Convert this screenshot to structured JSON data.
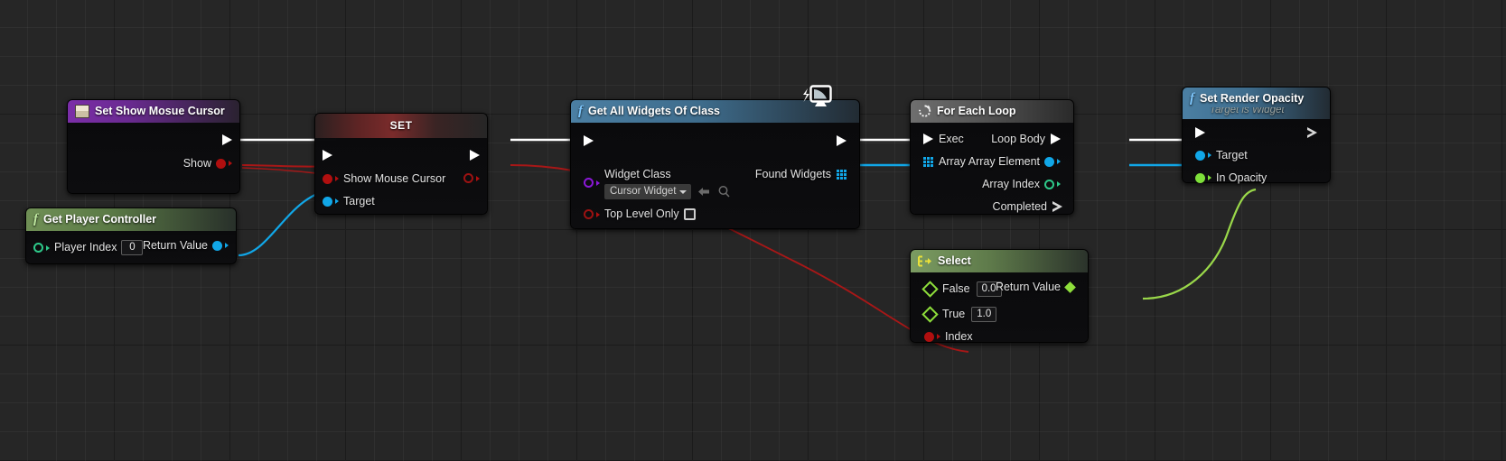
{
  "app": {
    "name": "Unreal Engine Blueprint Graph",
    "canvas_bg": "#262626",
    "grid_minor": "#2e2e2e",
    "grid_major": "#161616"
  },
  "nodes": [
    {
      "id": "set-show-mouse-cursor",
      "title": "Set Show Mosue Cursor",
      "subtitle": "",
      "header_color": "#7b2ea8",
      "icon": "variable-icon",
      "inputs": [],
      "outputs": [
        {
          "label": "",
          "pin": "exec-out-pin"
        },
        {
          "label": "Show",
          "pin": "bool-out-pin",
          "color": "#b00f0f"
        }
      ]
    },
    {
      "id": "set",
      "title": "SET",
      "subtitle": "",
      "header_color": "#7a2b2b",
      "icon": "",
      "inputs": [
        {
          "label": "",
          "pin": "exec-in-pin"
        },
        {
          "label": "Show Mouse Cursor",
          "pin": "bool-in-pin",
          "color": "#b00f0f"
        },
        {
          "label": "Target",
          "pin": "object-in-pin",
          "color": "#11a7e8"
        }
      ],
      "outputs": [
        {
          "label": "",
          "pin": "exec-out-pin"
        },
        {
          "label": "",
          "pin": "bool-out-pin",
          "color": "#b00f0f"
        }
      ]
    },
    {
      "id": "get-player-controller",
      "title": "Get Player Controller",
      "subtitle": "",
      "header_color": "#6f8f55",
      "icon": "function-icon",
      "inputs": [
        {
          "label": "Player Index",
          "pin": "int-in-pin",
          "value": "0",
          "color": "#2ec98a"
        }
      ],
      "outputs": [
        {
          "label": "Return Value",
          "pin": "object-out-pin",
          "color": "#11a7e8"
        }
      ]
    },
    {
      "id": "get-all-widgets-of-class",
      "title": "Get All Widgets Of Class",
      "subtitle": "",
      "header_color": "#4b7fa3",
      "icon": "function-icon",
      "badge": "monitor-icon",
      "inputs": [
        {
          "label": "",
          "pin": "exec-in-pin"
        },
        {
          "label": "Widget Class",
          "pin": "class-in-pin",
          "value": "Cursor Widget",
          "color": "#8b18d8"
        },
        {
          "label": "Top Level Only",
          "pin": "bool-in-pin",
          "value": "unchecked",
          "color": "#9c1212"
        }
      ],
      "outputs": [
        {
          "label": "",
          "pin": "exec-out-pin"
        },
        {
          "label": "Found Widgets",
          "pin": "array-out-pin",
          "color": "#11a7e8"
        }
      ]
    },
    {
      "id": "for-each-loop",
      "title": "For Each Loop",
      "subtitle": "",
      "header_color": "#6f6f6f",
      "icon": "loop-icon",
      "inputs": [
        {
          "label": "Exec",
          "pin": "exec-in-pin"
        },
        {
          "label": "Array",
          "pin": "array-in-pin",
          "color": "#11a7e8"
        }
      ],
      "outputs": [
        {
          "label": "Loop Body",
          "pin": "exec-out-pin"
        },
        {
          "label": "Array Element",
          "pin": "object-out-pin",
          "color": "#11a7e8"
        },
        {
          "label": "Array Index",
          "pin": "int-out-pin",
          "color": "#2ec98a"
        },
        {
          "label": "Completed",
          "pin": "exec-out-pin-hollow"
        }
      ]
    },
    {
      "id": "select",
      "title": "Select",
      "subtitle": "",
      "header_color": "#7b9b62",
      "icon": "select-icon",
      "inputs": [
        {
          "label": "False",
          "pin": "float-in-pin",
          "value": "0.0",
          "color": "#8ede3b"
        },
        {
          "label": "True",
          "pin": "float-in-pin",
          "value": "1.0",
          "color": "#8ede3b"
        },
        {
          "label": "Index",
          "pin": "bool-in-pin",
          "color": "#b00f0f"
        }
      ],
      "outputs": [
        {
          "label": "Return Value",
          "pin": "float-out-pin",
          "color": "#8ede3b"
        }
      ]
    },
    {
      "id": "set-render-opacity",
      "title": "Set Render Opacity",
      "subtitle": "Target is Widget",
      "header_color": "#4b7fa3",
      "icon": "function-icon",
      "inputs": [
        {
          "label": "",
          "pin": "exec-in-pin"
        },
        {
          "label": "Target",
          "pin": "object-in-pin",
          "color": "#11a7e8"
        },
        {
          "label": "In Opacity",
          "pin": "float-in-pin",
          "color": "#7ee03a"
        }
      ],
      "outputs": [
        {
          "label": "",
          "pin": "exec-out-pin-hollow"
        }
      ]
    }
  ],
  "wires": [
    {
      "from": "set-show-mouse-cursor.exec",
      "to": "set.exec",
      "color": "#ffffff",
      "type": "exec"
    },
    {
      "from": "set-show-mouse-cursor.show",
      "to": "set.show_mouse_cursor",
      "color": "#a81717",
      "type": "data"
    },
    {
      "from": "get-player-controller.return_value",
      "to": "set.target",
      "color": "#11a7e8",
      "type": "data"
    },
    {
      "from": "set.exec_out",
      "to": "get-all-widgets-of-class.exec",
      "color": "#ffffff",
      "type": "exec"
    },
    {
      "from": "set.bool_out",
      "to": "select.index",
      "color": "#a81717",
      "type": "data"
    },
    {
      "from": "get-all-widgets-of-class.exec_out",
      "to": "for-each-loop.exec",
      "color": "#ffffff",
      "type": "exec"
    },
    {
      "from": "get-all-widgets-of-class.found_widgets",
      "to": "for-each-loop.array",
      "color": "#11a7e8",
      "type": "data"
    },
    {
      "from": "for-each-loop.loop_body",
      "to": "set-render-opacity.exec",
      "color": "#ffffff",
      "type": "exec"
    },
    {
      "from": "for-each-loop.array_element",
      "to": "set-render-opacity.target",
      "color": "#11a7e8",
      "type": "data"
    },
    {
      "from": "select.return_value",
      "to": "set-render-opacity.in_opacity",
      "color": "#9ad84a",
      "type": "data"
    }
  ]
}
